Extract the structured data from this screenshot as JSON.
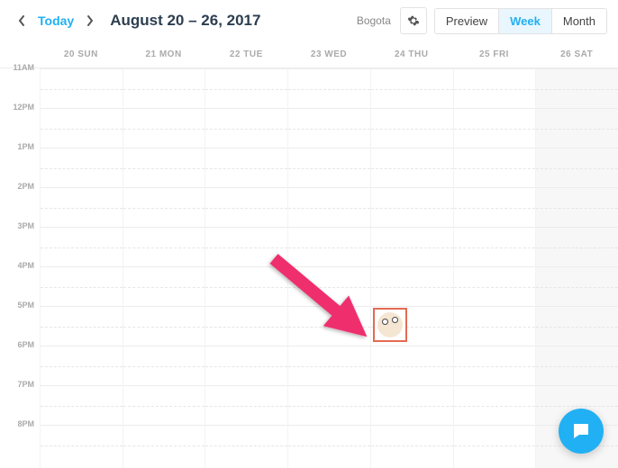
{
  "toolbar": {
    "today_label": "Today",
    "date_range": "August 20 – 26, 2017",
    "timezone": "Bogota",
    "preview_label": "Preview",
    "week_label": "Week",
    "month_label": "Month"
  },
  "day_headers": [
    "20 SUN",
    "21 MON",
    "22 TUE",
    "23 WED",
    "24 THU",
    "25 FRI",
    "26 SAT"
  ],
  "time_labels": [
    "11AM",
    "12PM",
    "1PM",
    "2PM",
    "3PM",
    "4PM",
    "5PM",
    "6PM",
    "7PM",
    "8PM"
  ],
  "event": {
    "day_index": 4,
    "hour_index": 6
  },
  "icons": {
    "prev": "chevron-left-icon",
    "next": "chevron-right-icon",
    "settings": "gear-icon",
    "chat": "chat-icon"
  }
}
